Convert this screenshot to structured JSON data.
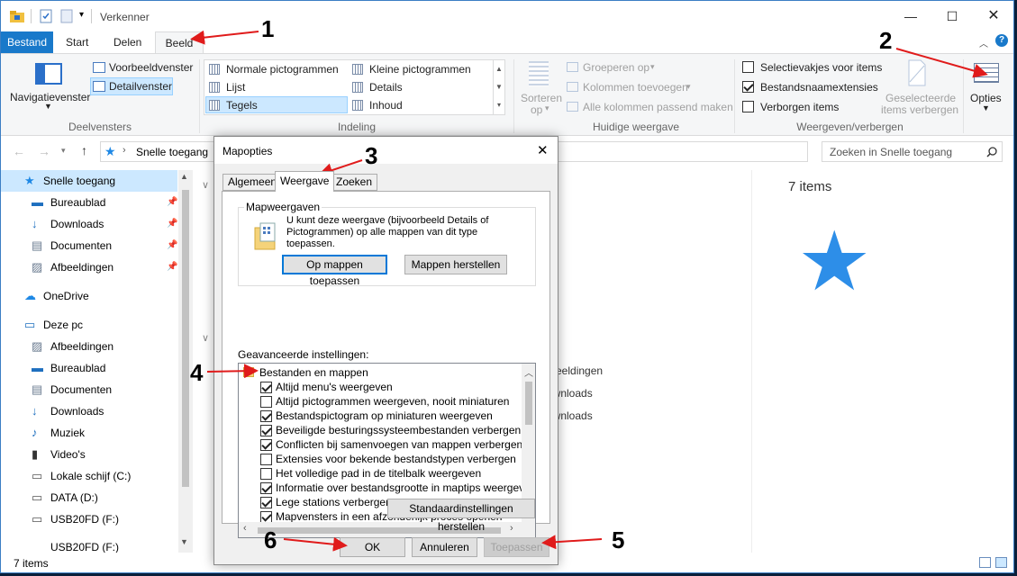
{
  "window": {
    "title": "Verkenner"
  },
  "tabs": [
    "Bestand",
    "Start",
    "Delen",
    "Beeld"
  ],
  "ribbon": {
    "panes": {
      "nav_pane": "Navigatievenster",
      "preview": "Voorbeeldvenster",
      "details": "Detailvenster",
      "group": "Deelvensters"
    },
    "layout": {
      "items": [
        "Normale pictogrammen",
        "Kleine pictogrammen",
        "Lijst",
        "Details",
        "Tegels",
        "Inhoud"
      ],
      "group": "Indeling",
      "selected": "Tegels"
    },
    "current_view": {
      "sort": "Sorteren",
      "sort2": "op",
      "group_by": "Groeperen op",
      "add_columns": "Kolommen toevoegen",
      "fit_columns": "Alle kolommen passend maken",
      "group": "Huidige weergave"
    },
    "show_hide": {
      "checkboxes": "Selectievakjes voor items",
      "extensions": "Bestandsnaamextensies",
      "hidden": "Verborgen items",
      "hide_selected": "Geselecteerde",
      "hide_selected2": "items verbergen",
      "group": "Weergeven/verbergen",
      "extensions_checked": true
    },
    "options": "Opties"
  },
  "address": {
    "path": "Snelle toegang",
    "search_placeholder": "Zoeken in Snelle toegang"
  },
  "nav": {
    "items": [
      {
        "label": "Snelle toegang",
        "pinned": false
      },
      {
        "label": "Bureaublad",
        "pinned": true
      },
      {
        "label": "Downloads",
        "pinned": true
      },
      {
        "label": "Documenten",
        "pinned": true
      },
      {
        "label": "Afbeeldingen",
        "pinned": true
      },
      {
        "label": "OneDrive"
      },
      {
        "label": "Deze pc"
      },
      {
        "label": "Afbeeldingen"
      },
      {
        "label": "Bureaublad"
      },
      {
        "label": "Documenten"
      },
      {
        "label": "Downloads"
      },
      {
        "label": "Muziek"
      },
      {
        "label": "Video's"
      },
      {
        "label": "Lokale schijf (C:)"
      },
      {
        "label": "DATA (D:)"
      },
      {
        "label": "USB20FD (F:)"
      },
      {
        "label": "USB20FD (F:)"
      }
    ]
  },
  "content": {
    "count": "7 items",
    "partial": [
      "fbeeldingen",
      "ownloads",
      "ownloads"
    ]
  },
  "status": {
    "text": "7 items"
  },
  "dialog": {
    "title": "Mapopties",
    "tabs": [
      "Algemeen",
      "Weergave",
      "Zoeken"
    ],
    "folder_views": {
      "heading": "Mapweergaven",
      "desc1": "U kunt deze weergave (bijvoorbeeld Details of",
      "desc2": "Pictogrammen) op alle mappen van dit type",
      "desc3": "toepassen.",
      "apply": "Op mappen toepassen",
      "reset": "Mappen herstellen"
    },
    "advanced_label": "Geavanceerde instellingen:",
    "tree": {
      "root": "Bestanden en mappen",
      "items": [
        {
          "label": "Altijd menu's weergeven",
          "checked": true
        },
        {
          "label": "Altijd pictogrammen weergeven, nooit miniaturen",
          "checked": false
        },
        {
          "label": "Bestandspictogram op miniaturen weergeven",
          "checked": true
        },
        {
          "label": "Beveiligde besturingssysteembestanden verbergen (aanb",
          "checked": true
        },
        {
          "label": "Conflicten bij samenvoegen van mappen verbergen",
          "checked": true
        },
        {
          "label": "Extensies voor bekende bestandstypen verbergen",
          "checked": false
        },
        {
          "label": "Het volledige pad in de titelbalk weergeven",
          "checked": false
        },
        {
          "label": "Informatie over bestandsgrootte in maptips weergeven",
          "checked": true
        },
        {
          "label": "Lege stations verbergen",
          "checked": true
        },
        {
          "label": "Mapvensters in een afzonderlijk proces openen",
          "checked": true
        }
      ]
    },
    "restore_defaults": "Standaardinstellingen herstellen",
    "ok": "OK",
    "cancel": "Annuleren",
    "apply": "Toepassen"
  },
  "annotations": [
    "1",
    "2",
    "3",
    "4",
    "5",
    "6"
  ],
  "colors": {
    "accent": "#1979ca",
    "selected": "#cce8ff",
    "arrow": "#e01b1b"
  }
}
